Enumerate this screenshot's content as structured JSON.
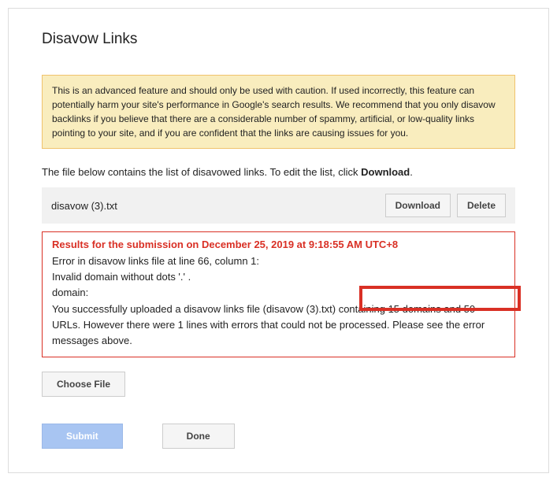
{
  "page": {
    "title": "Disavow Links"
  },
  "warning": {
    "text": "This is an advanced feature and should only be used with caution. If used incorrectly, this feature can potentially harm your site's performance in Google's search results. We recommend that you only disavow backlinks if you believe that there are a considerable number of spammy, artificial, or low-quality links pointing to your site, and if you are confident that the links are causing issues for you."
  },
  "instruction": {
    "prefix": "The file below contains the list of disavowed links. To edit the list, click ",
    "bold": "Download",
    "suffix": "."
  },
  "file": {
    "name": "disavow (3).txt",
    "download_label": "Download",
    "delete_label": "Delete"
  },
  "results": {
    "header": "Results for the submission on December 25, 2019 at 9:18:55 AM UTC+8",
    "line1": "Error in disavow links file at line 66, column 1:",
    "line2": "Invalid domain without dots '.' .",
    "line3": "domain:",
    "line4": "You successfully uploaded a disavow links file (disavow (3).txt) containing 15 domains and 50 URLs. However there were 1 lines with errors that could not be processed. Please see the error messages above."
  },
  "actions": {
    "choose_file": "Choose File",
    "submit": "Submit",
    "done": "Done"
  }
}
